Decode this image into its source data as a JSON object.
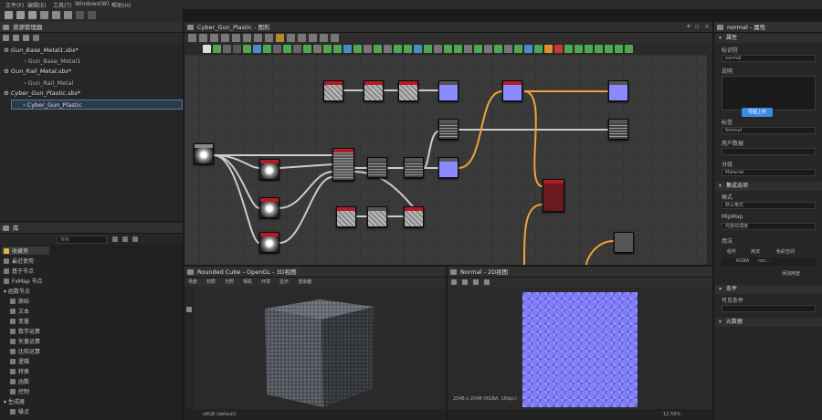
{
  "menu": [
    "文件(F)",
    "编辑(E)",
    "工具(T)",
    "Windows(W)",
    "帮助(H)"
  ],
  "explorer": {
    "title": "资源管理器",
    "packages": [
      {
        "name": "Gun_Base_Metal1.sbs*",
        "graph": "Gun_Base_Metal1"
      },
      {
        "name": "Gun_Rail_Metal.sbs*",
        "graph": "Gun_Rail_Metal"
      },
      {
        "name": "Cyber_Gun_Plastic.sbs*",
        "graph": "Cyber_Gun_Plastic"
      }
    ]
  },
  "library": {
    "title": "库",
    "search_placeholder": "搜索",
    "categories": [
      "收藏夹",
      "最近使用",
      "基于节点",
      "FxMap 节点",
      "函数节点",
      "原始",
      "文本",
      "变量",
      "数学运算",
      "矢量运算",
      "比较运算",
      "逻辑",
      "转换",
      "函数",
      "控制",
      "生成器",
      "噪点"
    ]
  },
  "graph": {
    "title": "Cyber_Gun_Plastic - 图形"
  },
  "view3d": {
    "title": "Rounded Cube - OpenGL - 3D视图",
    "menus": [
      "场景",
      "材质",
      "光照",
      "相机",
      "环境",
      "显示",
      "渲染器"
    ],
    "status": "sRGB (default)"
  },
  "view2d": {
    "title": "Normal - 2D视图",
    "info": "2048 x 2048 (RGBA, 16bpc)",
    "zoom": "12.59%"
  },
  "properties": {
    "title": "normal - 属性",
    "section_attr": "属性",
    "label_id": "标识符",
    "value_id": "normal",
    "label_desc": "说明",
    "upload_btn": "导图上传",
    "label_tag": "标签",
    "value_tag": "Normal",
    "label_userdata": "用户数据",
    "label_group": "分组",
    "value_group": "Material",
    "section_integration": "集成选项",
    "label_style": "格式",
    "value_style": "默认格式",
    "label_mipmap": "MipMap",
    "value_mipmap": "完整纹理链",
    "label_usage": "用法",
    "col_component": "组件",
    "col_usage": "用法",
    "col_colorspace": "色彩空间",
    "usage_component": "RGBA",
    "usage_value": "nor...",
    "add_usage": "添加用途",
    "section_condition": "条件",
    "label_visible": "可见条件",
    "section_graph": "元数据"
  },
  "colors": {
    "accent": "#f0a33a",
    "red_node": "#b31c25",
    "normal_blue": "#8a8aff"
  }
}
